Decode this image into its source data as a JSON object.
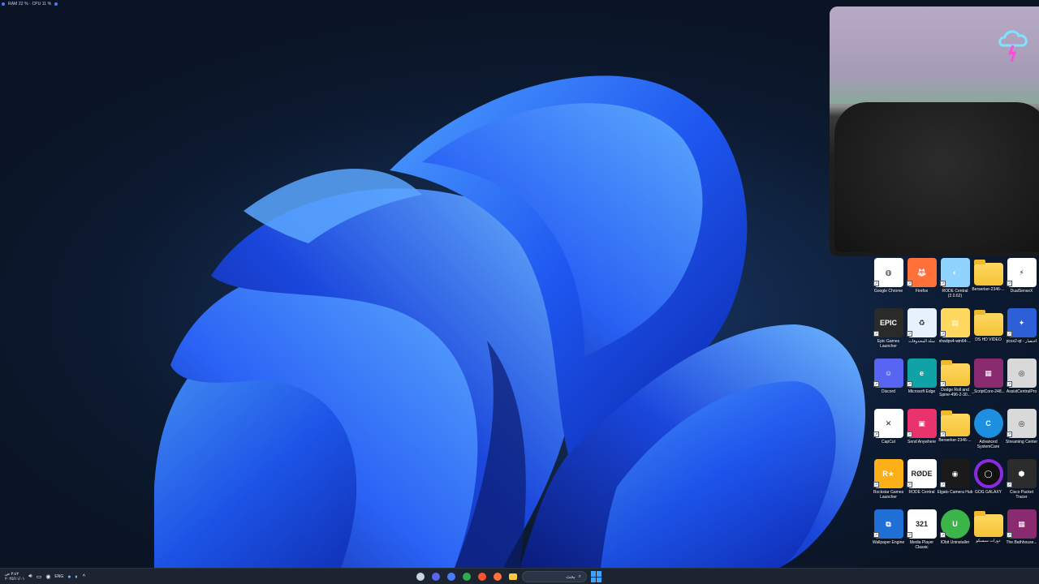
{
  "overlay": {
    "perf_text": "RAM 22 % · CPU 11 %"
  },
  "desktop_icons": [
    {
      "label": "Google Chrome",
      "icon": "chrome-icon",
      "color": "#ffffff"
    },
    {
      "label": "Firefox",
      "icon": "firefox-icon",
      "color": "#ff7139"
    },
    {
      "label": "RODE Central (2.0.62)",
      "icon": "rode-central-icon",
      "color": "#8fd3ff"
    },
    {
      "label": "Berserker-2346-...",
      "icon": "folder-icon",
      "color": "#ffd862"
    },
    {
      "label": "DualSenseX",
      "icon": "dualsensex-icon",
      "color": "#ffffff"
    },
    {
      "label": "Epic Games Launcher",
      "icon": "epic-games-icon",
      "color": "#2a2a2a"
    },
    {
      "label": "سلة المحذوفات",
      "icon": "recycle-bin-icon",
      "color": "#e8f2ff"
    },
    {
      "label": "shadps4-win64-...",
      "icon": "shadps4-icon",
      "color": "#ffd862"
    },
    {
      "label": "DS HD VIDEO",
      "icon": "folder-icon",
      "color": "#ffd862"
    },
    {
      "label": "pcsx2-qt - اختصار",
      "icon": "pcsx2-icon",
      "color": "#2d5fd6"
    },
    {
      "label": "Discord",
      "icon": "discord-icon",
      "color": "#5865f2"
    },
    {
      "label": "Microsoft Edge",
      "icon": "edge-icon",
      "color": "#0fa3a8"
    },
    {
      "label": "Dodge Roll and Spine-496-2-30...",
      "icon": "folder-icon",
      "color": "#ffd862"
    },
    {
      "label": "_ScriptCore-248...",
      "icon": "winrar-icon",
      "color": "#8a2b6f"
    },
    {
      "label": "AssistCentralPro",
      "icon": "airovision-icon",
      "color": "#d9d9d9"
    },
    {
      "label": "CapCut",
      "icon": "capcut-icon",
      "color": "#ffffff"
    },
    {
      "label": "Send Anywhere",
      "icon": "send-anywhere-icon",
      "color": "#e8336c"
    },
    {
      "label": "Berserker-2346-...",
      "icon": "folder-icon",
      "color": "#ffd862"
    },
    {
      "label": "Advanced SystemCare",
      "icon": "advanced-systemcare-icon",
      "color": "#1d8fe0"
    },
    {
      "label": "Streaming Center",
      "icon": "streaming-center-icon",
      "color": "#d9d9d9"
    },
    {
      "label": "Rockstar Games Launcher",
      "icon": "rockstar-icon",
      "color": "#fcaf17"
    },
    {
      "label": "RODE Central",
      "icon": "rode-icon",
      "color": "#ffffff"
    },
    {
      "label": "Elgato Camera Hub",
      "icon": "elgato-icon",
      "color": "#1a1a1a"
    },
    {
      "label": "GOG GALAXY",
      "icon": "gog-galaxy-icon",
      "color": "#8a2be2"
    },
    {
      "label": "Cisco Packet Tracer",
      "icon": "cisco-packet-tracer-icon",
      "color": "#2c2c2c"
    },
    {
      "label": "Wallpaper Engine",
      "icon": "wallpaper-engine-icon",
      "color": "#1f6fd6"
    },
    {
      "label": "Media Player Classic",
      "icon": "media-player-classic-icon",
      "color": "#ffffff"
    },
    {
      "label": "IObit Uninstaller",
      "icon": "iobit-uninstaller-icon",
      "color": "#3bb54a"
    },
    {
      "label": "دورات سيسكو",
      "icon": "folder-icon",
      "color": "#ffd862"
    },
    {
      "label": "The.Bathhouse...",
      "icon": "winrar-icon",
      "color": "#8a2b6f"
    }
  ],
  "taskbar": {
    "clock_time": "٣:٤٣ ص",
    "clock_date": "٢٠٢٥/١١/٠١",
    "language": "ENG",
    "search_placeholder": "بحث",
    "apps": [
      {
        "icon": "copilot-icon",
        "color": "#c9d3e2"
      },
      {
        "icon": "discord-taskbar-icon",
        "color": "#5865f2"
      },
      {
        "icon": "media-app-icon",
        "color": "#4a7bff"
      },
      {
        "icon": "chrome-taskbar-icon",
        "color": "#34a853"
      },
      {
        "icon": "brave-icon",
        "color": "#fb542b"
      },
      {
        "icon": "firefox-taskbar-icon",
        "color": "#ff7139"
      },
      {
        "icon": "file-explorer-icon",
        "color": "#ffc83d"
      }
    ],
    "store_icon_color": "#d9e6f7"
  }
}
